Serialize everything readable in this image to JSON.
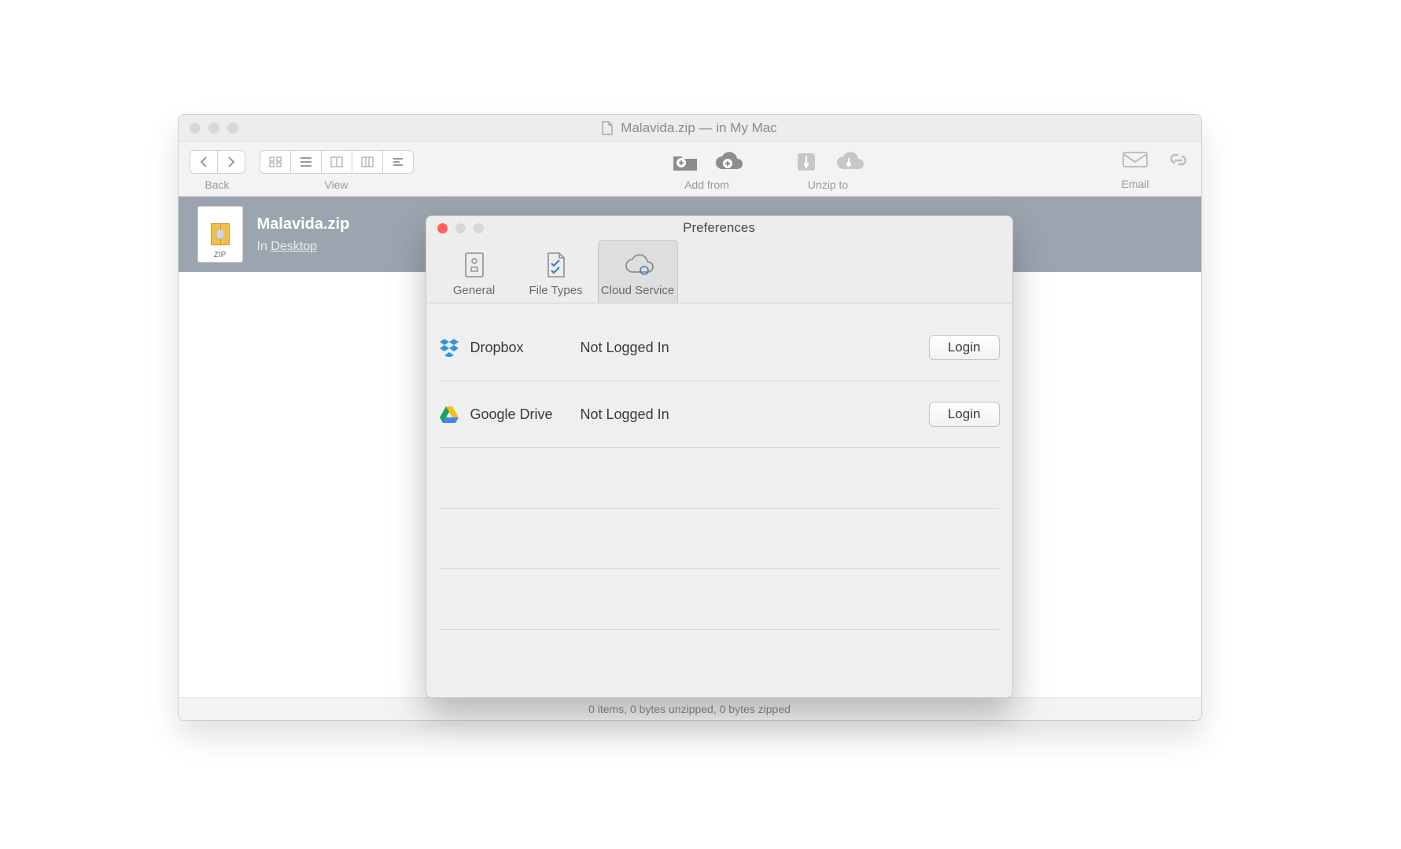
{
  "main_window": {
    "title": "Malavida.zip — in My Mac",
    "toolbar": {
      "back_label": "Back",
      "view_label": "View",
      "add_from_label": "Add from",
      "unzip_to_label": "Unzip to",
      "email_label": "Email"
    },
    "file": {
      "name": "Malavida.zip",
      "location_prefix": "In ",
      "location": "Desktop"
    },
    "status": "0 items, 0 bytes unzipped, 0 bytes zipped"
  },
  "preferences": {
    "title": "Preferences",
    "tabs": {
      "general": "General",
      "file_types": "File Types",
      "cloud_service": "Cloud Service"
    },
    "services": [
      {
        "name": "Dropbox",
        "status": "Not Logged In",
        "button": "Login"
      },
      {
        "name": "Google Drive",
        "status": "Not Logged In",
        "button": "Login"
      }
    ]
  }
}
